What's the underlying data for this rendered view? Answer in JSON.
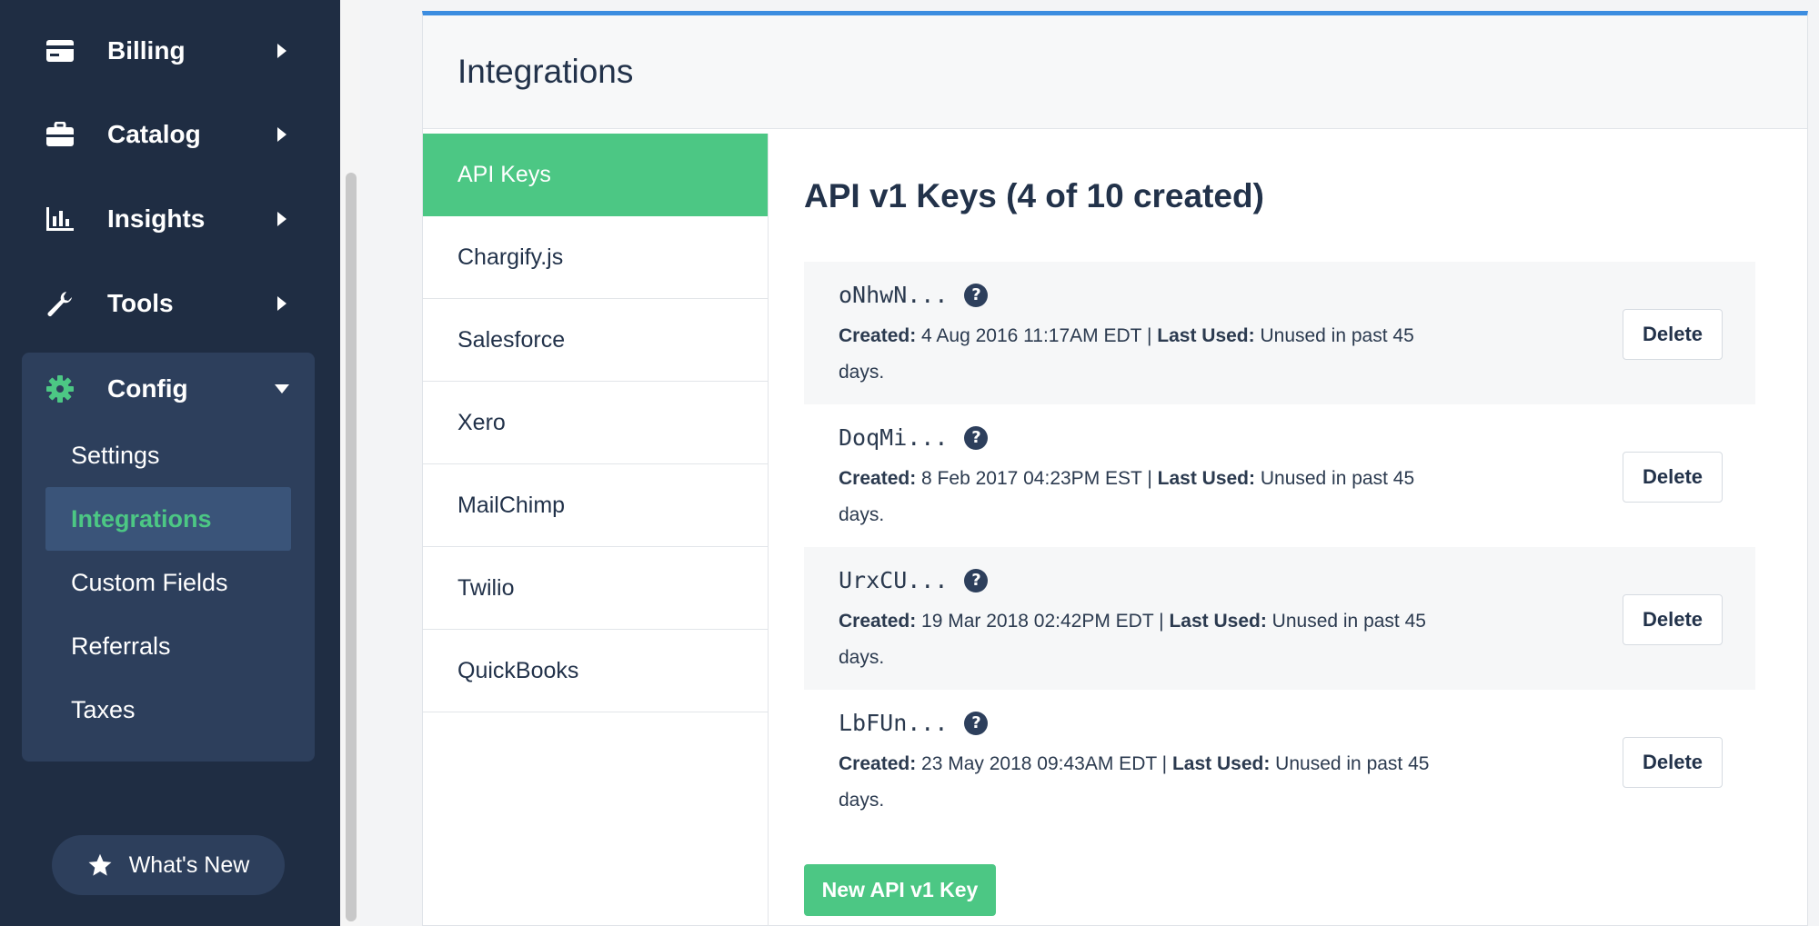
{
  "sidebar": {
    "items": [
      {
        "label": "Billing",
        "icon": "credit-card-icon"
      },
      {
        "label": "Catalog",
        "icon": "briefcase-icon"
      },
      {
        "label": "Insights",
        "icon": "bar-chart-icon"
      },
      {
        "label": "Tools",
        "icon": "wrench-icon"
      }
    ],
    "config": {
      "label": "Config",
      "icon": "gear-icon",
      "subitems": [
        "Settings",
        "Integrations",
        "Custom Fields",
        "Referrals",
        "Taxes"
      ],
      "active": "Integrations"
    },
    "whats_new": "What's New"
  },
  "page": {
    "title": "Integrations"
  },
  "tabs": [
    "API Keys",
    "Chargify.js",
    "Salesforce",
    "Xero",
    "MailChimp",
    "Twilio",
    "QuickBooks"
  ],
  "active_tab": "API Keys",
  "api": {
    "heading": "API v1 Keys (4 of 10 created)",
    "created_label": "Created:",
    "last_used_label": "Last Used:",
    "delete_label": "Delete",
    "keys": [
      {
        "name": "oNhwN...",
        "created": "4 Aug 2016 11:17AM EDT",
        "separator": "|",
        "last_used": "Unused in past 45 days."
      },
      {
        "name": "DoqMi...",
        "created": "8 Feb 2017 04:23PM EST",
        "separator": "|",
        "last_used": "Unused in past 45 days."
      },
      {
        "name": "UrxCU...",
        "created": "19 Mar 2018 02:42PM EDT",
        "separator": "|",
        "last_used": "Unused in past 45 days."
      },
      {
        "name": "LbFUn...",
        "created": "23 May 2018 09:43AM EDT",
        "separator": "|",
        "last_used": "Unused in past 45 days."
      }
    ],
    "new_key_button": "New API v1 Key"
  },
  "colors": {
    "sidebar_bg": "#1f2d43",
    "accent_green": "#4cc784",
    "header_border": "#3c8de0"
  }
}
